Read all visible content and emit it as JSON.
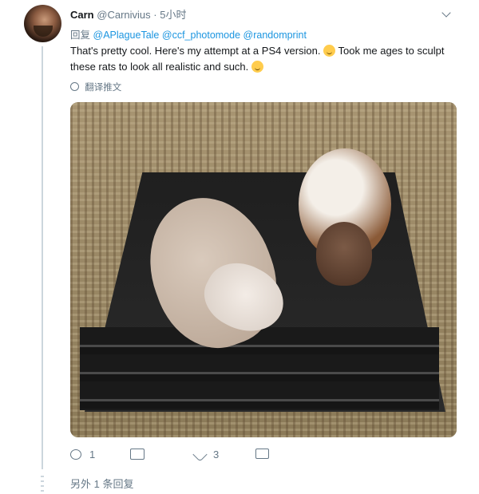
{
  "tweet": {
    "name": "Carn",
    "handle": "@Carnivius",
    "time": "5小时",
    "reply_prefix": "回复",
    "mentions": [
      "@APlagueTale",
      "@ccf_photomode",
      "@randomprint"
    ],
    "text_part1": "That's pretty cool. Here's my attempt at a PS4 version.",
    "text_part2": "Took me ages to sculpt these rats to look all realistic and such.",
    "translate_label": "翻译推文",
    "reply_count": "1",
    "retweet_count": "",
    "like_count": "3"
  },
  "thread": {
    "more_replies_label": "另外 1 条回复"
  },
  "icons": {
    "reply": "reply-icon",
    "retweet": "retweet-icon",
    "like": "like-icon",
    "dm": "dm-icon",
    "globe": "globe-icon",
    "caret": "chevron-down-icon"
  },
  "colors": {
    "name": "#14171a",
    "secondary": "#657786",
    "mention": "#1b95e0",
    "thread_line": "#ccd6dd"
  }
}
